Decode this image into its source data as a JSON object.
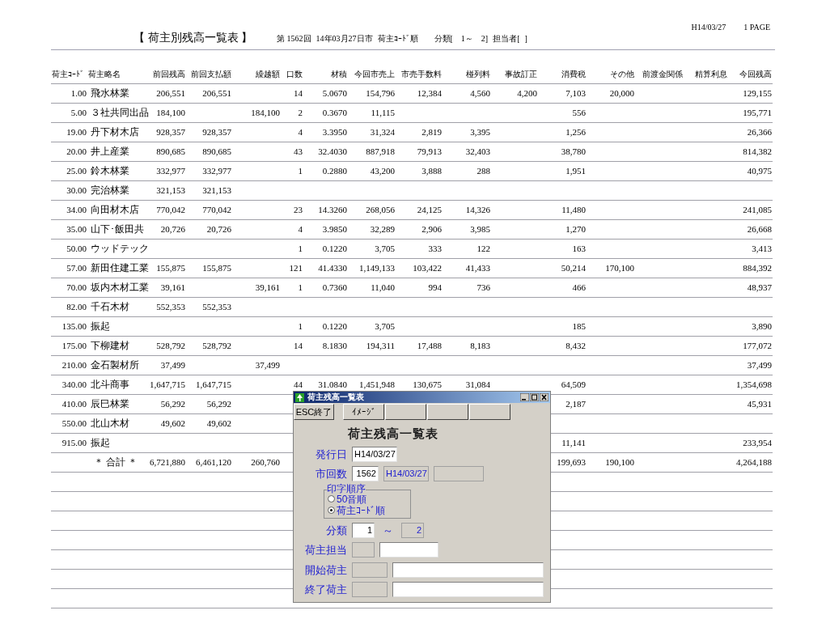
{
  "report": {
    "title": "【 荷主別残高一覧表 】",
    "info": [
      "第 1562回",
      "14年03月27日市",
      "荷主ｺｰﾄﾞ順",
      "分類[　1～　2]",
      "担当者[",
      "]"
    ],
    "date": "H14/03/27",
    "page": "1 PAGE"
  },
  "table": {
    "columns": [
      "荷主ｺｰﾄﾞ",
      "荷主略名",
      "前回残高",
      "前回支払額",
      "繰越額",
      "口数",
      "材積",
      "今回市売上",
      "市売手数料",
      "椪列料",
      "事故訂正",
      "消費税",
      "その他",
      "前渡金関係",
      "精算利息",
      "今回残高"
    ],
    "rows": [
      {
        "kind": "data",
        "cells": [
          "1.00",
          "飛水林業",
          "206,551",
          "206,551",
          null,
          "14",
          "5.0670",
          "154,796",
          "12,384",
          "4,560",
          "4,200",
          "7,103",
          "20,000",
          null,
          null,
          "129,155"
        ]
      },
      {
        "kind": "data",
        "cells": [
          "5.00",
          "３社共同出品",
          "184,100",
          null,
          "184,100",
          "2",
          "0.3670",
          "11,115",
          null,
          null,
          null,
          "556",
          null,
          null,
          null,
          "195,771"
        ]
      },
      {
        "kind": "data",
        "cells": [
          "19.00",
          "丹下材木店",
          "928,357",
          "928,357",
          null,
          "4",
          "3.3950",
          "31,324",
          "2,819",
          "3,395",
          null,
          "1,256",
          null,
          null,
          null,
          "26,366"
        ]
      },
      {
        "kind": "data",
        "cells": [
          "20.00",
          "井上産業",
          "890,685",
          "890,685",
          null,
          "43",
          "32.4030",
          "887,918",
          "79,913",
          "32,403",
          null,
          "38,780",
          null,
          null,
          null,
          "814,382"
        ]
      },
      {
        "kind": "data",
        "cells": [
          "25.00",
          "鈴木林業",
          "332,977",
          "332,977",
          null,
          "1",
          "0.2880",
          "43,200",
          "3,888",
          "288",
          null,
          "1,951",
          null,
          null,
          null,
          "40,975"
        ]
      },
      {
        "kind": "data",
        "cells": [
          "30.00",
          "完治林業",
          "321,153",
          "321,153",
          null,
          null,
          null,
          null,
          null,
          null,
          null,
          null,
          null,
          null,
          null,
          null
        ]
      },
      {
        "kind": "data",
        "cells": [
          "34.00",
          "向田材木店",
          "770,042",
          "770,042",
          null,
          "23",
          "14.3260",
          "268,056",
          "24,125",
          "14,326",
          null,
          "11,480",
          null,
          null,
          null,
          "241,085"
        ]
      },
      {
        "kind": "data",
        "cells": [
          "35.00",
          "山下･飯田共",
          "20,726",
          "20,726",
          null,
          "4",
          "3.9850",
          "32,289",
          "2,906",
          "3,985",
          null,
          "1,270",
          null,
          null,
          null,
          "26,668"
        ]
      },
      {
        "kind": "data",
        "cells": [
          "50.00",
          "ウッドテック",
          null,
          null,
          null,
          "1",
          "0.1220",
          "3,705",
          "333",
          "122",
          null,
          "163",
          null,
          null,
          null,
          "3,413"
        ]
      },
      {
        "kind": "data",
        "cells": [
          "57.00",
          "新田住建工業",
          "155,875",
          "155,875",
          null,
          "121",
          "41.4330",
          "1,149,133",
          "103,422",
          "41,433",
          null,
          "50,214",
          "170,100",
          null,
          null,
          "884,392"
        ]
      },
      {
        "kind": "data",
        "cells": [
          "70.00",
          "坂内木材工業",
          "39,161",
          null,
          "39,161",
          "1",
          "0.7360",
          "11,040",
          "994",
          "736",
          null,
          "466",
          null,
          null,
          null,
          "48,937"
        ]
      },
      {
        "kind": "data",
        "cells": [
          "82.00",
          "千石木材",
          "552,353",
          "552,353",
          null,
          null,
          null,
          null,
          null,
          null,
          null,
          null,
          null,
          null,
          null,
          null
        ]
      },
      {
        "kind": "data",
        "cells": [
          "135.00",
          "振起",
          null,
          null,
          null,
          "1",
          "0.1220",
          "3,705",
          null,
          null,
          null,
          "185",
          null,
          null,
          null,
          "3,890"
        ]
      },
      {
        "kind": "data",
        "cells": [
          "175.00",
          "下柳建材",
          "528,792",
          "528,792",
          null,
          "14",
          "8.1830",
          "194,311",
          "17,488",
          "8,183",
          null,
          "8,432",
          null,
          null,
          null,
          "177,072"
        ]
      },
      {
        "kind": "data",
        "cells": [
          "210.00",
          "金石製材所",
          "37,499",
          null,
          "37,499",
          null,
          null,
          null,
          null,
          null,
          null,
          null,
          null,
          null,
          null,
          "37,499"
        ]
      },
      {
        "kind": "data",
        "cells": [
          "340.00",
          "北斗商事",
          "1,647,715",
          "1,647,715",
          null,
          "44",
          "31.0840",
          "1,451,948",
          "130,675",
          "31,084",
          null,
          "64,509",
          null,
          null,
          null,
          "1,354,698"
        ]
      },
      {
        "kind": "data",
        "cells": [
          "410.00",
          "辰巳林業",
          "56,292",
          "56,292",
          null,
          null,
          null,
          null,
          null,
          null,
          null,
          "2,187",
          null,
          null,
          null,
          "45,931"
        ]
      },
      {
        "kind": "data",
        "cells": [
          "550.00",
          "北山木材",
          "49,602",
          "49,602",
          null,
          null,
          null,
          null,
          null,
          null,
          null,
          null,
          null,
          null,
          null,
          null
        ]
      },
      {
        "kind": "data",
        "cells": [
          "915.00",
          "振起",
          null,
          null,
          null,
          null,
          null,
          null,
          null,
          null,
          null,
          "11,141",
          null,
          null,
          null,
          "233,954"
        ]
      },
      {
        "kind": "total",
        "cells": [
          null,
          "＊ 合計 ＊",
          "6,721,880",
          "6,461,120",
          "260,760",
          null,
          null,
          null,
          null,
          null,
          null,
          "199,693",
          "190,100",
          null,
          null,
          "4,264,188"
        ]
      }
    ]
  },
  "dialog": {
    "title": "荷主残高一覧表",
    "toolbar": [
      {
        "kind": "label",
        "label": "ESC終了"
      },
      {
        "kind": "label",
        "label": "ｲﾒｰｼﾞ"
      },
      {
        "kind": "blank"
      },
      {
        "kind": "blank"
      },
      {
        "kind": "blank"
      }
    ],
    "heading": "荷主残高一覧表",
    "body": [
      {
        "kind": "fields",
        "label": "発行日",
        "fields": [
          {
            "kind": "date",
            "value": "H14/03/27",
            "disabled": false
          }
        ]
      },
      {
        "kind": "fields",
        "label": "市回数",
        "fields": [
          {
            "kind": "number",
            "value": "1562",
            "disabled": false
          },
          {
            "kind": "date",
            "value": "H14/03/27",
            "disabled": true
          },
          {
            "kind": "blank",
            "disabled": true
          }
        ]
      },
      {
        "kind": "radios",
        "legend": "印字順序",
        "options": [
          {
            "label": "50音順",
            "selected": false
          },
          {
            "label": "荷主ｺｰﾄﾞ順",
            "selected": true
          }
        ]
      },
      {
        "kind": "fields",
        "label": "分類",
        "fields": [
          {
            "kind": "code",
            "value": "1",
            "disabled": false
          },
          {
            "kind": "separator",
            "value": "～"
          },
          {
            "kind": "code",
            "value": "2",
            "disabled": true
          }
        ]
      },
      {
        "kind": "fields",
        "label": "荷主担当",
        "fields": [
          {
            "kind": "code",
            "disabled": true
          },
          {
            "kind": "name",
            "disabled": false
          }
        ]
      },
      {
        "kind": "fields",
        "label": "開始荷主",
        "fields": [
          {
            "kind": "owner",
            "disabled": true
          },
          {
            "kind": "wide",
            "disabled": false
          }
        ]
      },
      {
        "kind": "fields",
        "label": "終了荷主",
        "fields": [
          {
            "kind": "owner",
            "disabled": true
          },
          {
            "kind": "wide",
            "disabled": false
          }
        ]
      }
    ]
  }
}
